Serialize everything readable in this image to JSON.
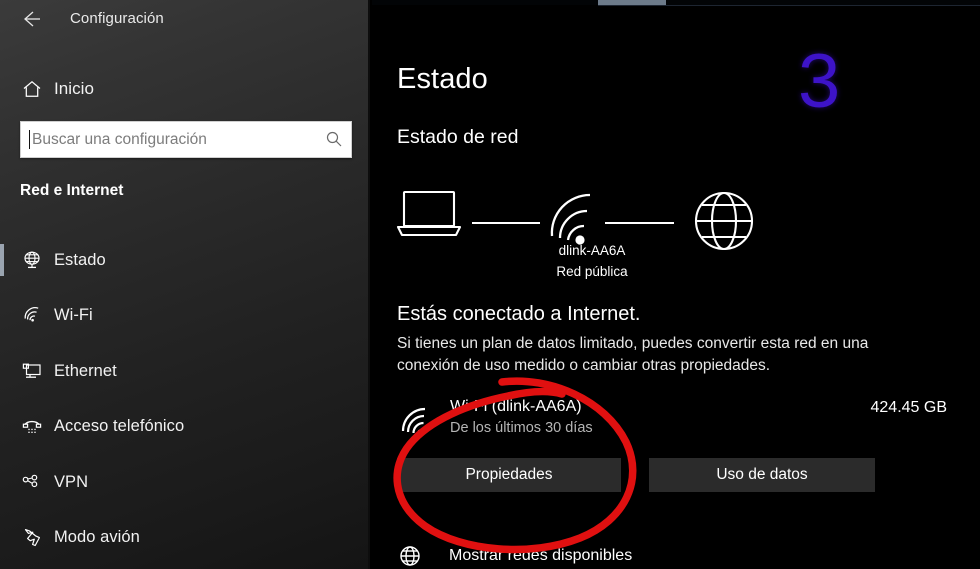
{
  "window": {
    "title": "Configuración",
    "back_icon": "back-arrow-icon"
  },
  "sidebar": {
    "home": {
      "label": "Inicio",
      "icon": "home-icon"
    },
    "search": {
      "placeholder": "Buscar una configuración",
      "value": "",
      "icon": "search-icon"
    },
    "section_label": "Red e Internet",
    "items": [
      {
        "label": "Estado",
        "icon": "globe-monitor-icon",
        "selected": true
      },
      {
        "label": "Wi-Fi",
        "icon": "wifi-icon",
        "selected": false
      },
      {
        "label": "Ethernet",
        "icon": "ethernet-icon",
        "selected": false
      },
      {
        "label": "Acceso telefónico",
        "icon": "dial-up-phone-icon",
        "selected": false
      },
      {
        "label": "VPN",
        "icon": "vpn-icon",
        "selected": false
      },
      {
        "label": "Modo avión",
        "icon": "airplane-icon",
        "selected": false
      }
    ]
  },
  "main": {
    "page_title": "Estado",
    "section_heading": "Estado de red",
    "diagram": {
      "device_icon": "laptop-icon",
      "network_icon": "wifi-icon",
      "internet_icon": "globe-icon",
      "network_name": "dlink-AA6A",
      "network_type": "Red pública"
    },
    "status_line": "Estás conectado a Internet.",
    "status_description": "Si tienes un plan de datos limitado, puedes convertir esta red en una conexión de uso medido o cambiar otras propiedades.",
    "usage": {
      "icon": "wifi-icon",
      "title": "Wi-Fi (dlink-AA6A)",
      "subtitle": "De los últimos 30 días",
      "amount": "424.45 GB"
    },
    "buttons": {
      "properties": "Propiedades",
      "data_usage": "Uso de datos"
    },
    "show_networks": {
      "label": "Mostrar redes disponibles",
      "icon": "globe-icon"
    }
  },
  "annotations": {
    "step_number": "3",
    "step_number_color": "#3d13c8",
    "circle_color": "#e01010",
    "circle_target": "Propiedades"
  }
}
